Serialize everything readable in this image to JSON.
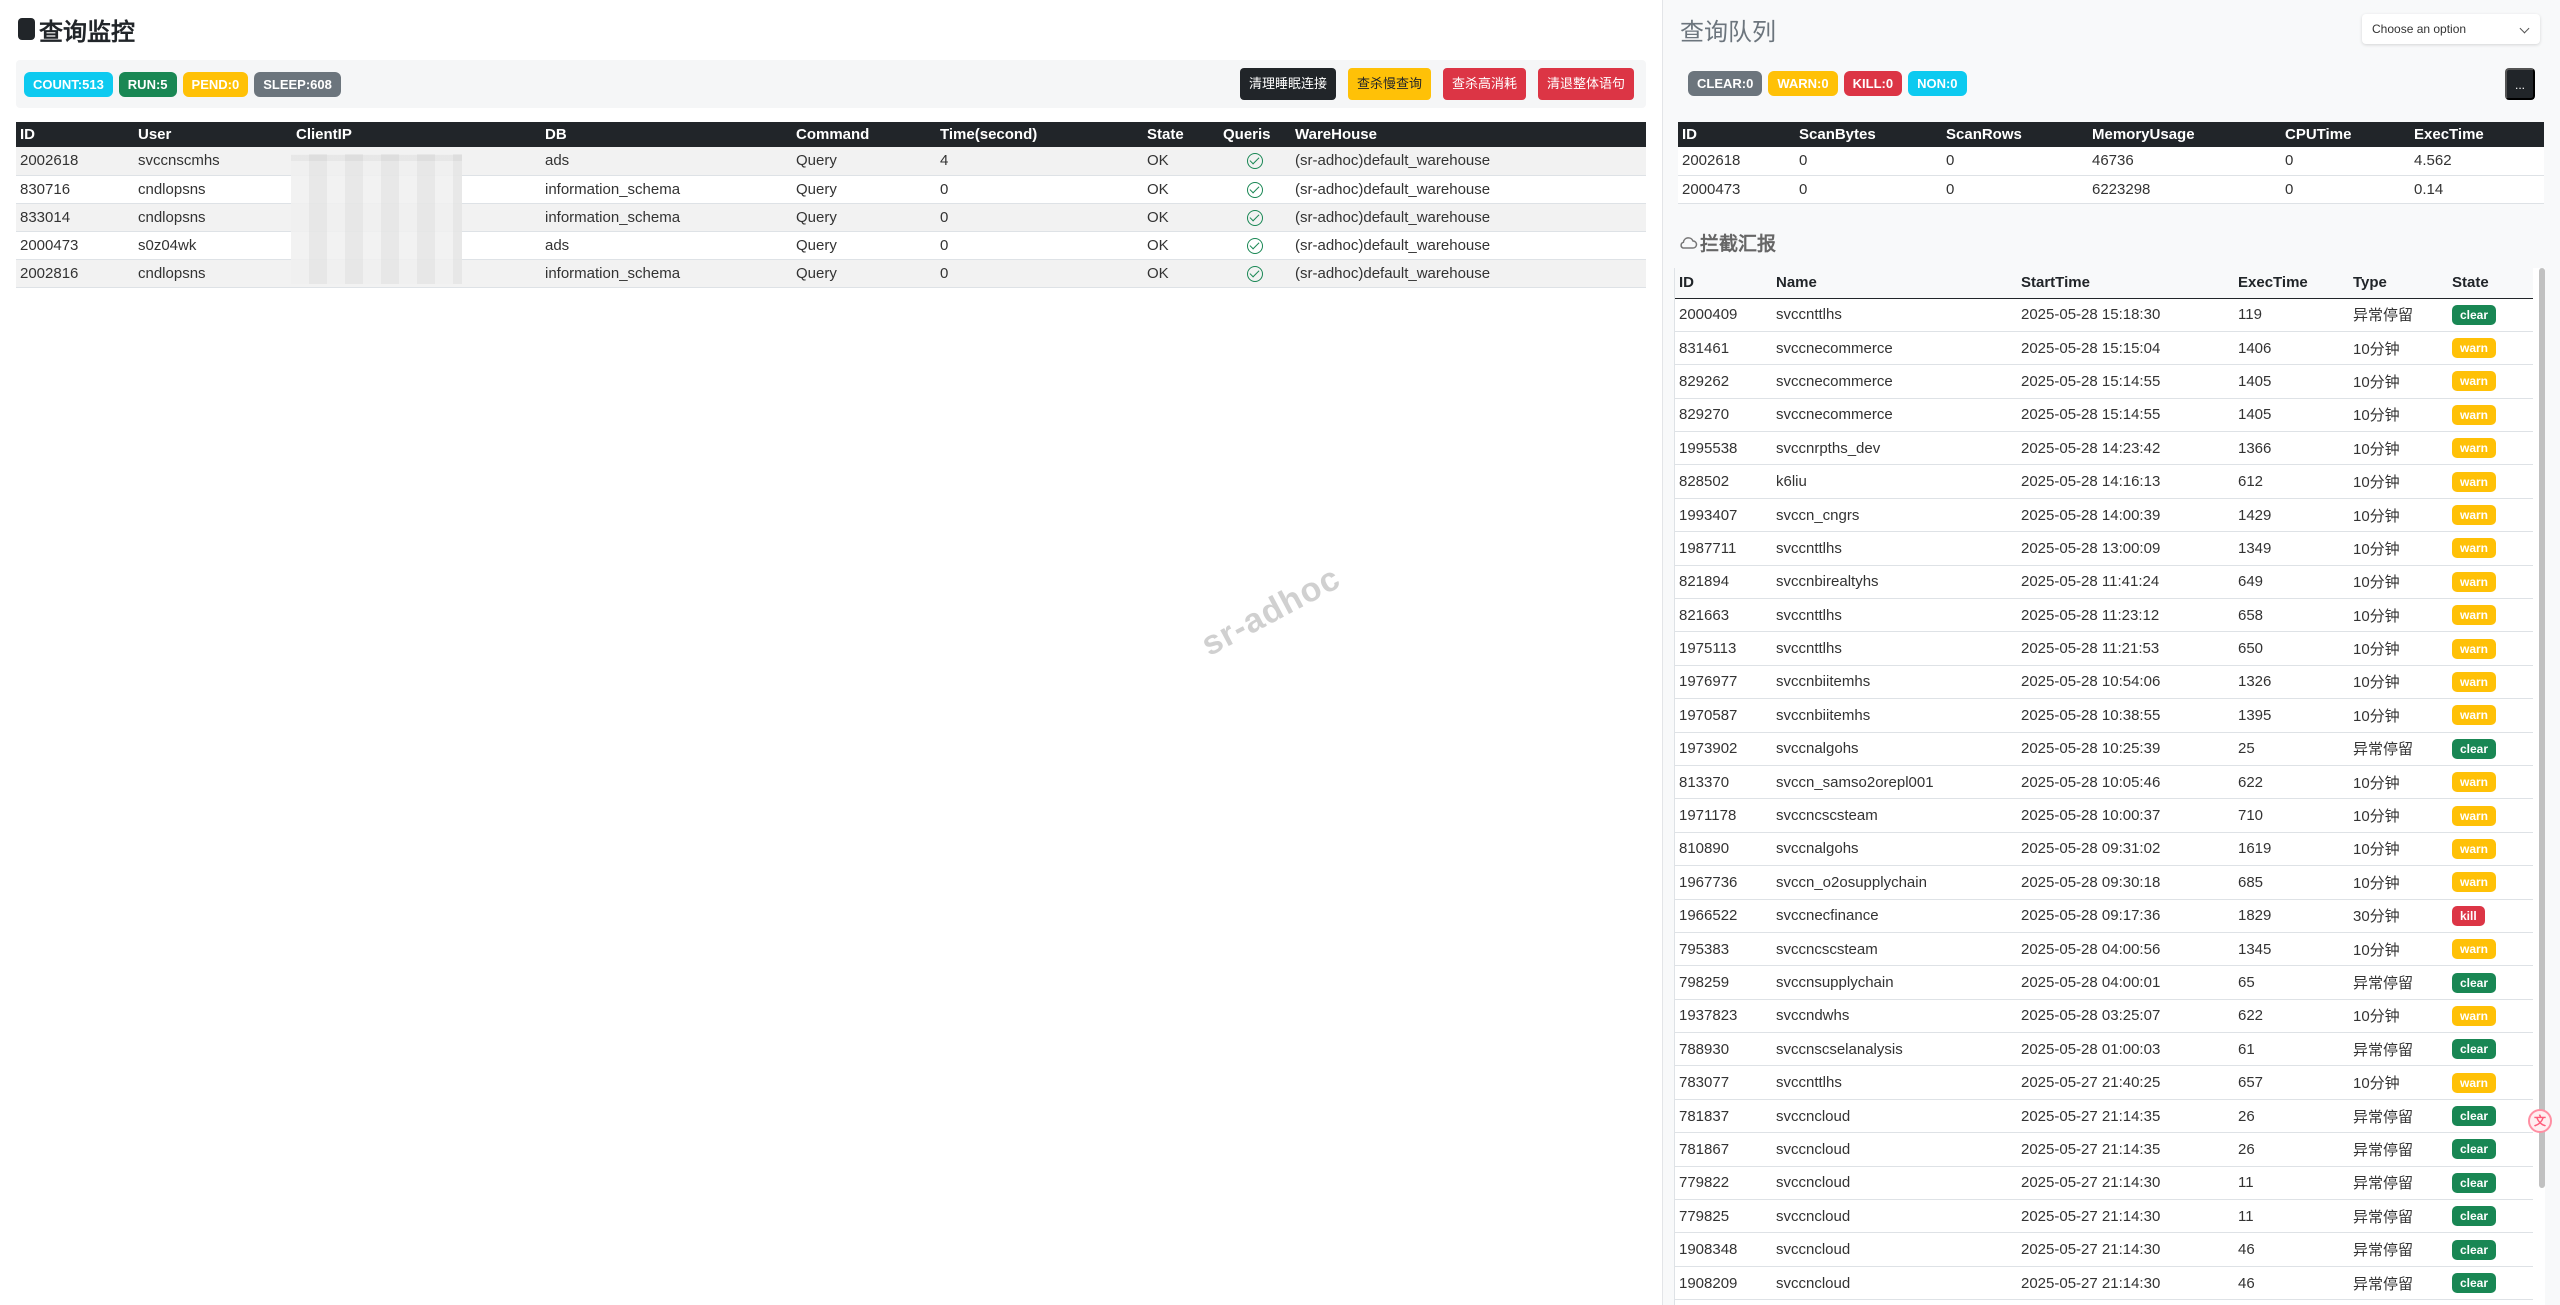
{
  "left": {
    "title": "查询监控",
    "badges": [
      "COUNT:513",
      "RUN:5",
      "PEND:0",
      "SLEEP:608"
    ],
    "actions": [
      "清理睡眠连接",
      "查杀慢查询",
      "查杀高消耗",
      "清退整体语句"
    ],
    "watermark": "sr-adhoc",
    "columns": [
      "ID",
      "User",
      "ClientIP",
      "DB",
      "Command",
      "Time(second)",
      "State",
      "Queris",
      "WareHouse"
    ],
    "rows": [
      {
        "id": "2002618",
        "user": "svccnscmhs",
        "db": "ads",
        "command": "Query",
        "time": "4",
        "state": "OK",
        "warehouse": "(sr-adhoc)default_warehouse"
      },
      {
        "id": "830716",
        "user": "cndlopsns",
        "db": "information_schema",
        "command": "Query",
        "time": "0",
        "state": "OK",
        "warehouse": "(sr-adhoc)default_warehouse"
      },
      {
        "id": "833014",
        "user": "cndlopsns",
        "db": "information_schema",
        "command": "Query",
        "time": "0",
        "state": "OK",
        "warehouse": "(sr-adhoc)default_warehouse"
      },
      {
        "id": "2000473",
        "user": "s0z04wk",
        "db": "ads",
        "command": "Query",
        "time": "0",
        "state": "OK",
        "warehouse": "(sr-adhoc)default_warehouse"
      },
      {
        "id": "2002816",
        "user": "cndlopsns",
        "db": "information_schema",
        "command": "Query",
        "time": "0",
        "state": "OK",
        "warehouse": "(sr-adhoc)default_warehouse"
      }
    ]
  },
  "right": {
    "title": "查询队列",
    "select_placeholder": "Choose an option",
    "badges": [
      "CLEAR:0",
      "WARN:0",
      "KILL:0",
      "NON:0"
    ],
    "more_button": "...",
    "queue_columns": [
      "ID",
      "ScanBytes",
      "ScanRows",
      "MemoryUsage",
      "CPUTime",
      "ExecTime"
    ],
    "queue_rows": [
      [
        "2002618",
        "0",
        "0",
        "46736",
        "0",
        "4.562"
      ],
      [
        "2000473",
        "0",
        "0",
        "6223298",
        "0",
        "0.14"
      ]
    ],
    "report_title": "拦截汇报",
    "report_columns": [
      "ID",
      "Name",
      "StartTime",
      "ExecTime",
      "Type",
      "State"
    ],
    "report_rows": [
      [
        "2000409",
        "svccnttlhs",
        "2025-05-28 15:18:30",
        "119",
        "异常停留",
        "clear"
      ],
      [
        "831461",
        "svccnecommerce",
        "2025-05-28 15:15:04",
        "1406",
        "10分钟",
        "warn"
      ],
      [
        "829262",
        "svccnecommerce",
        "2025-05-28 15:14:55",
        "1405",
        "10分钟",
        "warn"
      ],
      [
        "829270",
        "svccnecommerce",
        "2025-05-28 15:14:55",
        "1405",
        "10分钟",
        "warn"
      ],
      [
        "1995538",
        "svccnrpths_dev",
        "2025-05-28 14:23:42",
        "1366",
        "10分钟",
        "warn"
      ],
      [
        "828502",
        "k6liu",
        "2025-05-28 14:16:13",
        "612",
        "10分钟",
        "warn"
      ],
      [
        "1993407",
        "svccn_cngrs",
        "2025-05-28 14:00:39",
        "1429",
        "10分钟",
        "warn"
      ],
      [
        "1987711",
        "svccnttlhs",
        "2025-05-28 13:00:09",
        "1349",
        "10分钟",
        "warn"
      ],
      [
        "821894",
        "svccnbirealtyhs",
        "2025-05-28 11:41:24",
        "649",
        "10分钟",
        "warn"
      ],
      [
        "821663",
        "svccnttlhs",
        "2025-05-28 11:23:12",
        "658",
        "10分钟",
        "warn"
      ],
      [
        "1975113",
        "svccnttlhs",
        "2025-05-28 11:21:53",
        "650",
        "10分钟",
        "warn"
      ],
      [
        "1976977",
        "svccnbiitemhs",
        "2025-05-28 10:54:06",
        "1326",
        "10分钟",
        "warn"
      ],
      [
        "1970587",
        "svccnbiitemhs",
        "2025-05-28 10:38:55",
        "1395",
        "10分钟",
        "warn"
      ],
      [
        "1973902",
        "svccnalgohs",
        "2025-05-28 10:25:39",
        "25",
        "异常停留",
        "clear"
      ],
      [
        "813370",
        "svccn_samso2orepl001",
        "2025-05-28 10:05:46",
        "622",
        "10分钟",
        "warn"
      ],
      [
        "1971178",
        "svccncscsteam",
        "2025-05-28 10:00:37",
        "710",
        "10分钟",
        "warn"
      ],
      [
        "810890",
        "svccnalgohs",
        "2025-05-28 09:31:02",
        "1619",
        "10分钟",
        "warn"
      ],
      [
        "1967736",
        "svccn_o2osupplychain",
        "2025-05-28 09:30:18",
        "685",
        "10分钟",
        "warn"
      ],
      [
        "1966522",
        "svccnecfinance",
        "2025-05-28 09:17:36",
        "1829",
        "30分钟",
        "kill"
      ],
      [
        "795383",
        "svccncscsteam",
        "2025-05-28 04:00:56",
        "1345",
        "10分钟",
        "warn"
      ],
      [
        "798259",
        "svccnsupplychain",
        "2025-05-28 04:00:01",
        "65",
        "异常停留",
        "clear"
      ],
      [
        "1937823",
        "svccndwhs",
        "2025-05-28 03:25:07",
        "622",
        "10分钟",
        "warn"
      ],
      [
        "788930",
        "svccnscselanalysis",
        "2025-05-28 01:00:03",
        "61",
        "异常停留",
        "clear"
      ],
      [
        "783077",
        "svccnttlhs",
        "2025-05-27 21:40:25",
        "657",
        "10分钟",
        "warn"
      ],
      [
        "781837",
        "svccncloud",
        "2025-05-27 21:14:35",
        "26",
        "异常停留",
        "clear"
      ],
      [
        "781867",
        "svccncloud",
        "2025-05-27 21:14:35",
        "26",
        "异常停留",
        "clear"
      ],
      [
        "779822",
        "svccncloud",
        "2025-05-27 21:14:30",
        "11",
        "异常停留",
        "clear"
      ],
      [
        "779825",
        "svccncloud",
        "2025-05-27 21:14:30",
        "11",
        "异常停留",
        "clear"
      ],
      [
        "1908348",
        "svccncloud",
        "2025-05-27 21:14:30",
        "46",
        "异常停留",
        "clear"
      ],
      [
        "1908209",
        "svccncloud",
        "2025-05-27 21:14:30",
        "46",
        "异常停留",
        "clear"
      ]
    ]
  },
  "colors": {
    "dark": "#212529",
    "info": "#0dcaf0",
    "success": "#198754",
    "warning": "#ffc107",
    "secondary": "#6c757d",
    "danger": "#dc3545"
  },
  "icons": {
    "title": "bookmark-icon",
    "queris": "check-circle-icon",
    "report": "cloud-icon",
    "select": "chevron-down-icon"
  }
}
